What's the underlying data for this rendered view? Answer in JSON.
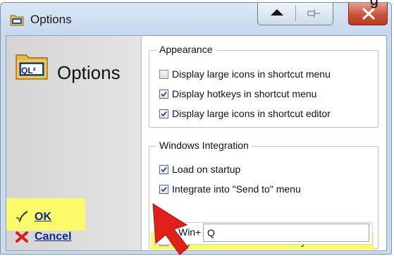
{
  "page_note": "g",
  "window": {
    "title": "Options",
    "buttons": {
      "up": "up-arrow-icon",
      "pin": "pin-icon",
      "close": "close-icon"
    }
  },
  "left_panel": {
    "icon_label": "QL²",
    "heading": "Options",
    "ok_label": "OK",
    "cancel_label": "Cancel"
  },
  "appearance": {
    "legend": "Appearance",
    "options": [
      {
        "label": "Display large icons in shortcut menu",
        "checked": false
      },
      {
        "label": "Display hotkeys in shortcut menu",
        "checked": true
      },
      {
        "label": "Display large icons in shortcut editor",
        "checked": true
      }
    ]
  },
  "windows_integration": {
    "legend": "Windows Integration",
    "options": [
      {
        "label": "Load on startup",
        "checked": true
      },
      {
        "label": "Integrate into \"Send to\" menu",
        "checked": true
      },
      {
        "label": "Register shortcut menu hotkey",
        "checked": false
      }
    ],
    "hotkey_prefix": "Win+",
    "hotkey_value": "Q"
  },
  "colors": {
    "highlight": "#fafa6a",
    "arrow": "#e0201a",
    "link": "#0a2a8a"
  }
}
